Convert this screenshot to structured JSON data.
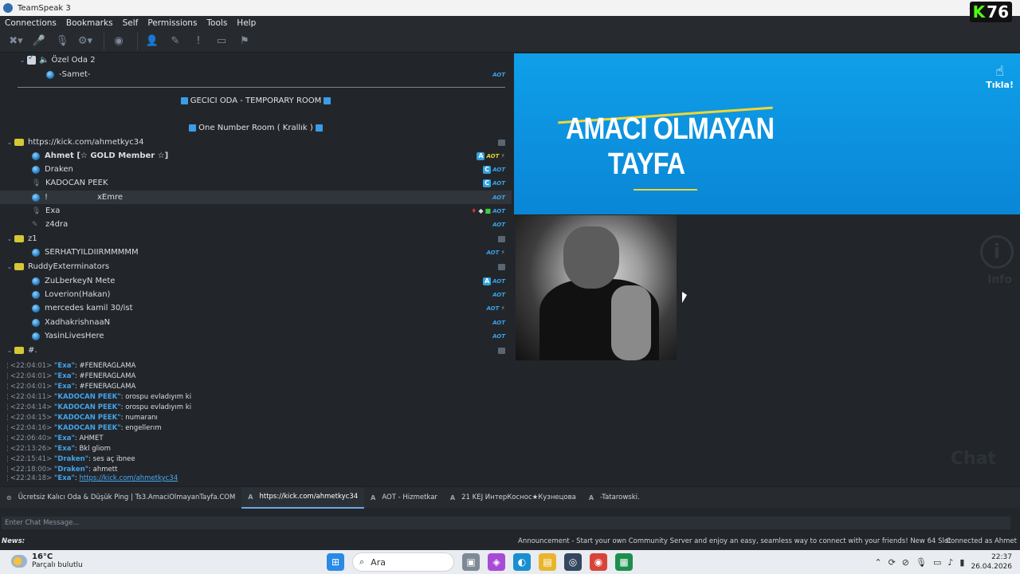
{
  "window": {
    "title": "TeamSpeak 3"
  },
  "badge": {
    "k": "K",
    "count": "76"
  },
  "menu": [
    "Connections",
    "Bookmarks",
    "Self",
    "Permissions",
    "Tools",
    "Help"
  ],
  "tree": {
    "ozel": "Özel Oda 2",
    "samet": "-Samet-",
    "gecici": "GECICI ODA - TEMPORARY ROOM",
    "onenumber": "One Number Room ( Krallık )",
    "kick_channel": "https://kick.com/ahmetkyc34",
    "users": [
      "Ahmet [☆ GOLD Member ☆]",
      "Draken",
      "KADOCAN PEEK",
      "!",
      "xEmre",
      "Exa",
      "z4dra"
    ],
    "z1": "z1",
    "serhat": "SERHATYILDIIRMMMMM",
    "ruddy": "RuddyExterminators",
    "ruddy_users": [
      "ZuLberkeyN Mete",
      "Loverion(Hakan)",
      "mercedes kamil 30/ist",
      "XadhakrishnaaN",
      "YasinLivesHere"
    ],
    "hash": "#.",
    "aot": "AOT",
    "c": "C",
    "a": "A"
  },
  "banner": {
    "line1": "AMACI OLMAYAN",
    "line2": "TAYFA",
    "tikla": "Tıkla!"
  },
  "ghost": {
    "info": "i",
    "info_label": "Info",
    "chat": "Chat"
  },
  "chat": [
    {
      "ts": "<22:04:01>",
      "name": "\"Exa\"",
      "msg": ": #FENERAGLAMA"
    },
    {
      "ts": "<22:04:01>",
      "name": "\"Exa\"",
      "msg": ": #FENERAGLAMA"
    },
    {
      "ts": "<22:04:01>",
      "name": "\"Exa\"",
      "msg": ": #FENERAGLAMA"
    },
    {
      "ts": "<22:04:11>",
      "name": "\"KADOCAN PEEK\"",
      "msg": ": orospu evladıyım ki"
    },
    {
      "ts": "<22:04:14>",
      "name": "\"KADOCAN PEEK\"",
      "msg": ": orospu evladıyım ki"
    },
    {
      "ts": "<22:04:15>",
      "name": "\"KADOCAN PEEK\"",
      "msg": ": numaranı"
    },
    {
      "ts": "<22:04:16>",
      "name": "\"KADOCAN PEEK\"",
      "msg": ": engellerım"
    },
    {
      "ts": "<22:06:40>",
      "name": "\"Exa\"",
      "msg": ": AHMET"
    },
    {
      "ts": "<22:13:26>",
      "name": "\"Exa\"",
      "msg": ": Bkl gliom"
    },
    {
      "ts": "<22:15:41>",
      "name": "\"Draken\"",
      "msg": ": ses aç ibnee"
    },
    {
      "ts": "<22:18:00>",
      "name": "\"Draken\"",
      "msg": ": ahmett"
    },
    {
      "ts": "<22:24:18>",
      "name": "\"Exa\"",
      "msg": ": ",
      "link": "https://kick.com/ahmetkyc34"
    }
  ],
  "tabs": [
    {
      "icon": "",
      "label": "Ücretsiz Kalıcı Oda & Düşük Ping | Ts3.AmaciOlmayanTayfa.COM"
    },
    {
      "icon": "A",
      "label": "https://kick.com/ahmetkyc34"
    },
    {
      "icon": "A",
      "label": "AOT - Hizmetkar"
    },
    {
      "icon": "A",
      "label": "21 KEJ ИнтерКоснос★Кузнецова"
    },
    {
      "icon": "A",
      "label": "-Tatarowski."
    }
  ],
  "input": {
    "placeholder": "Enter Chat Message..."
  },
  "status": {
    "news": "News:",
    "announcement": "Announcement - Start your own Community Server and enjoy an easy, seamless way to connect with your friends! New 64 Slot",
    "connected": "Connected as Ahmet"
  },
  "taskbar": {
    "temp": "16°C",
    "weather": "Parçalı bulutlu",
    "search": "Ara",
    "time": "22:37",
    "date": "26.04.2026"
  }
}
